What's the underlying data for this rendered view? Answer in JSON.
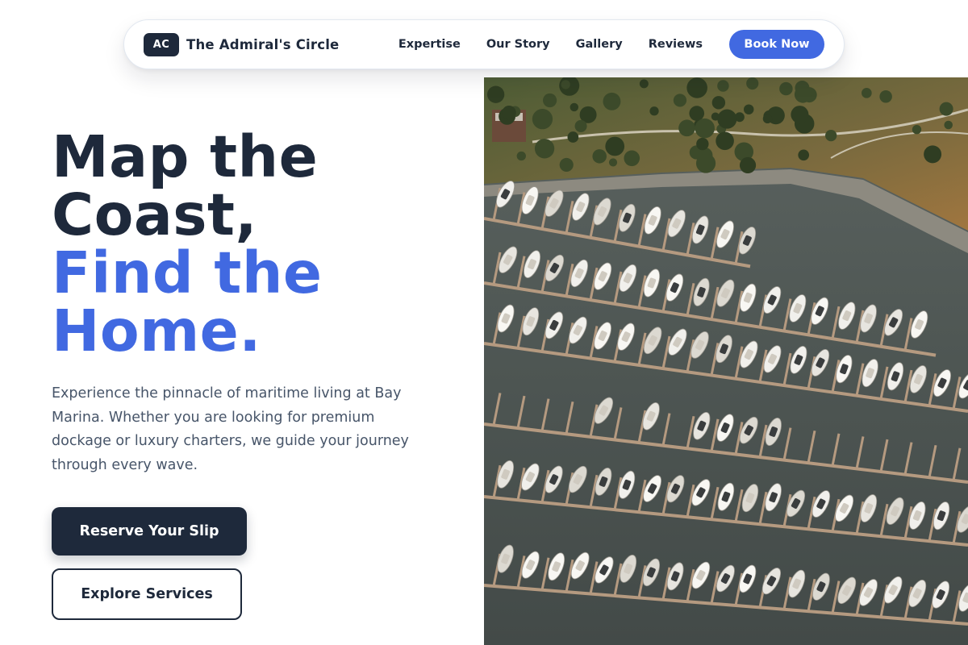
{
  "nav": {
    "logo_initials": "AC",
    "brand_name": "The Admiral's Circle",
    "links": [
      "Expertise",
      "Our Story",
      "Gallery",
      "Reviews"
    ],
    "cta_label": "Book Now"
  },
  "hero": {
    "headline_dark": [
      "Map the",
      "Coast,"
    ],
    "headline_accent": [
      "Find the",
      "Home."
    ],
    "description": "Experience the pinnacle of maritime living at Bay Marina. Whether you are looking for premium dockage or luxury charters, we guide your journey through every wave.",
    "primary_cta": "Reserve Your Slip",
    "secondary_cta": "Explore Services"
  },
  "image": {
    "subject": "aerial-marina-photo"
  },
  "colors": {
    "primary_dark": "#1e293b",
    "accent_blue": "#4169e1",
    "body_text": "#475569"
  }
}
